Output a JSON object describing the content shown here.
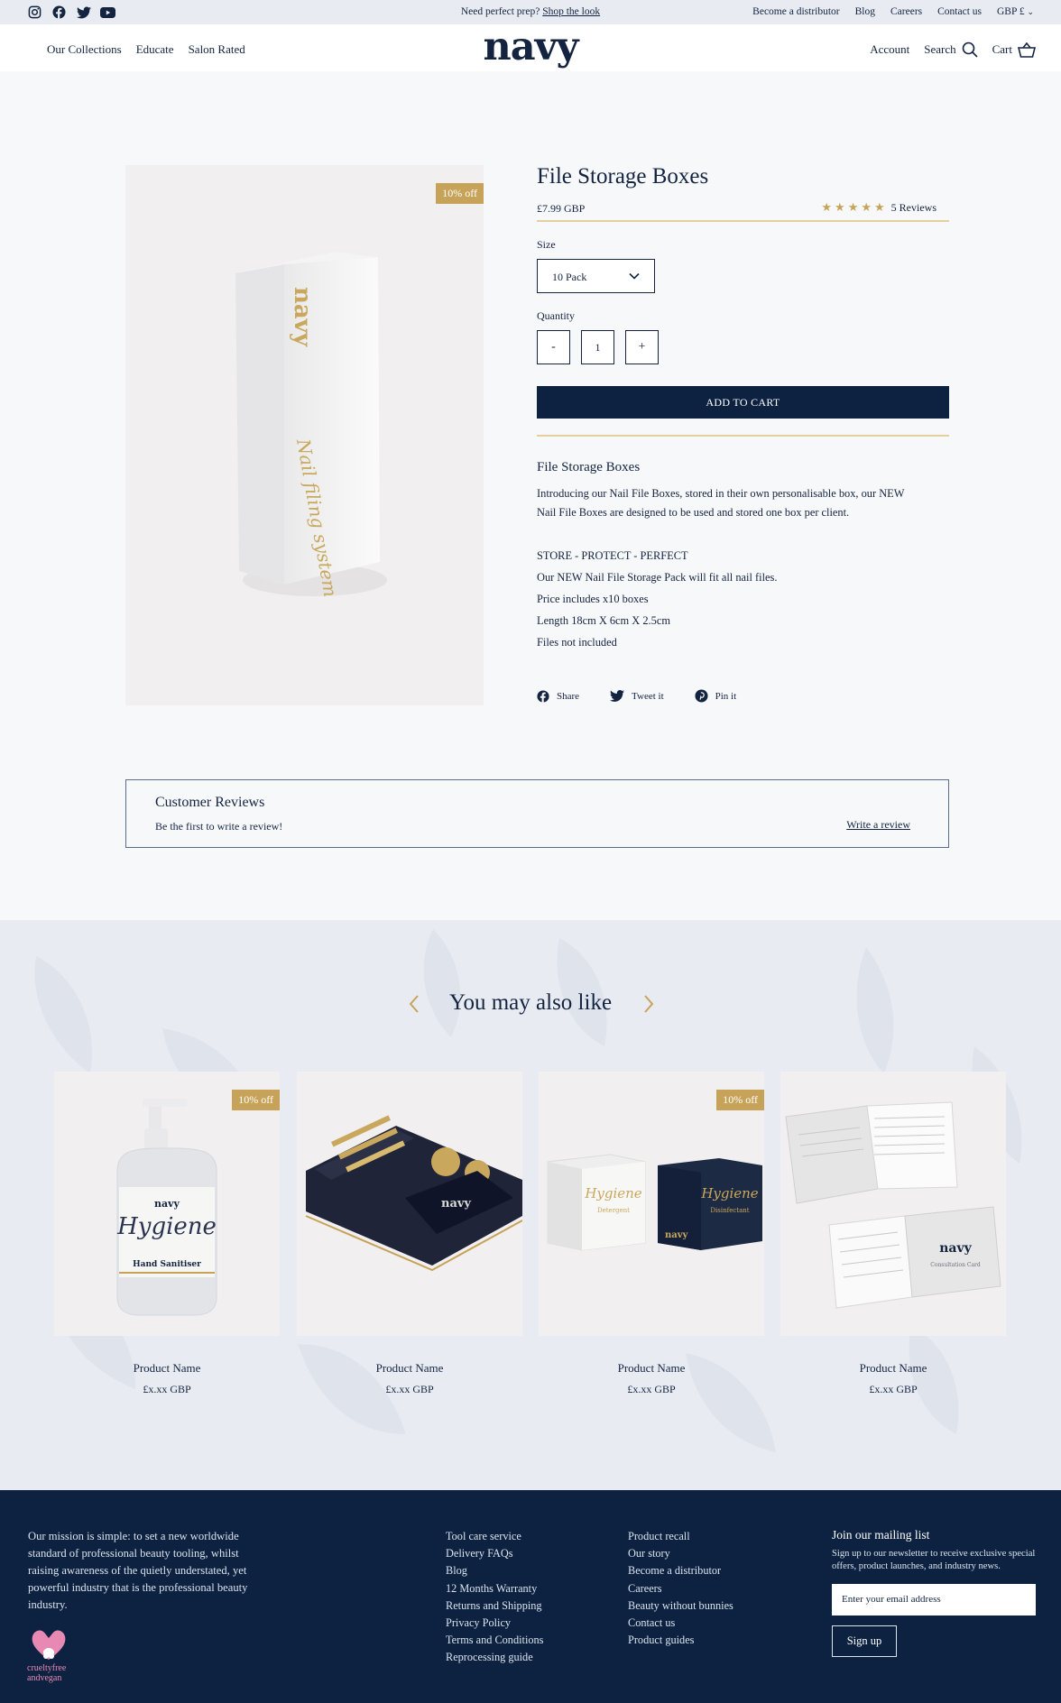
{
  "topbar": {
    "socials": [
      "instagram-icon",
      "facebook-icon",
      "twitter-icon",
      "youtube-icon"
    ],
    "announce_text": "Need perfect prep?",
    "announce_link": "Shop the look",
    "links": [
      "Become a distributor",
      "Blog",
      "Careers",
      "Contact us",
      "GBP £"
    ]
  },
  "header": {
    "nav": [
      "Our Collections",
      "Educate",
      "Salon Rated"
    ],
    "logo": "navy",
    "account": "Account",
    "search": "Search",
    "cart": "Cart"
  },
  "product": {
    "badge": "10% off",
    "title": "File Storage Boxes",
    "price": "£7.99 GBP",
    "rating": 5,
    "reviews_label": "5 Reviews",
    "size_label": "Size",
    "size_value": "10 Pack",
    "quantity_label": "Quantity",
    "minus": "-",
    "quantity": "1",
    "plus": "+",
    "add_to_cart": "ADD TO CART",
    "desc_title": "File Storage Boxes",
    "desc_intro": "Introducing our Nail File Boxes, stored in their own personalisable box, our NEW Nail File Boxes are designed to be used and stored one box per client.",
    "desc_lines": [
      "STORE - PROTECT - PERFECT",
      "Our NEW Nail File Storage Pack will fit all nail files.",
      "Price includes x10 boxes",
      "Length 18cm X 6cm X 2.5cm",
      "Files not included"
    ],
    "box_brand": "navy",
    "box_script": "Nail filing system",
    "share": "Share",
    "tweet": "Tweet it",
    "pin": "Pin it"
  },
  "reviews": {
    "title": "Customer Reviews",
    "empty": "Be the first to write a review!",
    "write": "Write a review"
  },
  "related": {
    "heading": "You may also like",
    "items": [
      {
        "name": "Product Name",
        "price": "£x.xx GBP",
        "badge": "10% off",
        "label_brand": "navy",
        "label_title": "Hygiene",
        "label_sub": "Hand Sanitiser"
      },
      {
        "name": "Product Name",
        "price": "£x.xx GBP",
        "badge": "",
        "label_brand": "navy"
      },
      {
        "name": "Product Name",
        "price": "£x.xx GBP",
        "badge": "10% off",
        "label_title": "Hygiene",
        "label_left": "Detergent",
        "label_right": "Disinfectant",
        "label_brand": "navy"
      },
      {
        "name": "Product Name",
        "price": "£x.xx GBP",
        "badge": "",
        "label_brand": "navy",
        "label_sub": "Consultation Card"
      }
    ]
  },
  "footer": {
    "mission": "Our mission is simple: to set a new worldwide standard of professional beauty tooling, whilst raising awareness of the quietly understated, yet powerful industry that is the professional beauty industry.",
    "col1": [
      "Tool care service",
      "Delivery FAQs",
      "Blog",
      "12 Months Warranty",
      "Returns and Shipping",
      "Privacy Policy",
      "Terms and Conditions",
      "Reprocessing guide"
    ],
    "col2": [
      "Product recall",
      "Our story",
      "Become a distributor",
      "Careers",
      "Beauty without bunnies",
      "Contact us",
      "Product guides"
    ],
    "mail_title": "Join our mailing list",
    "mail_text": "Sign up to our newsletter to receive exclusive special offers, product launches, and industry news.",
    "email_placeholder": "Enter your email address",
    "signup": "Sign up",
    "cf_line1": "crueltyfree",
    "cf_line2": "andvegan"
  },
  "colors": {
    "navy": "#0c2240",
    "gold": "#c7a35a",
    "bg": "#f7f8fa",
    "panel": "#e8ecf2"
  }
}
